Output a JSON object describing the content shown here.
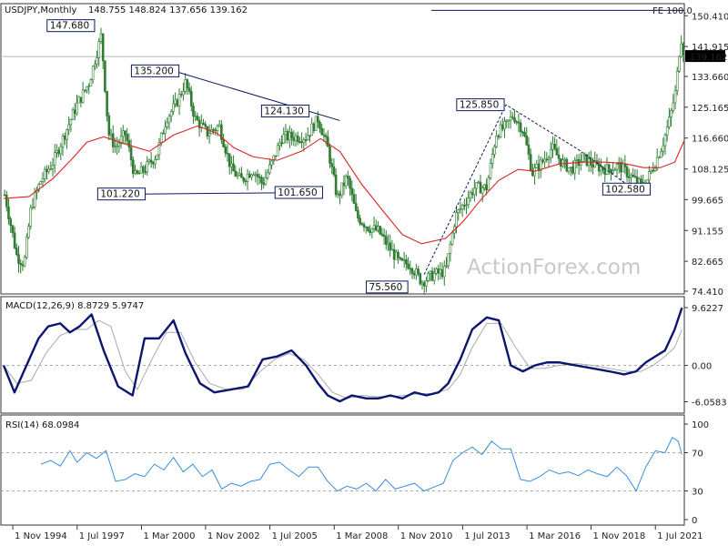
{
  "header": {
    "title": "USDJPY,Monthly",
    "ohlc": "148.755 148.824 137.656 139.162"
  },
  "watermark": "ActionForex.com",
  "fe_label": "FE 100.0",
  "current_price_label": "139.162",
  "colors": {
    "candle": "#2e7d32",
    "sma": "#dd2222",
    "macd": "#0d1570",
    "macd_signal": "#aaaaaa",
    "rsi": "#3a8fd9",
    "trendline": "#0d1a5c",
    "label_border": "#0d1a5c",
    "price_marker_bg": "#000000"
  },
  "chart_data": [
    {
      "type": "candlestick",
      "panel": "price",
      "title": "USDJPY,Monthly",
      "ylim": [
        74.4,
        153.0
      ],
      "y_ticks": [
        150.41,
        141.915,
        133.66,
        125.165,
        116.66,
        108.125,
        99.665,
        91.155,
        82.665,
        74.41
      ],
      "x_ticks": [
        "1 Nov 1994",
        "1 Jul 1997",
        "1 Mar 2000",
        "1 Nov 2002",
        "1 Jul 2005",
        "1 Mar 2008",
        "1 Nov 2010",
        "1 Jul 2013",
        "1 Mar 2016",
        "1 Nov 2018",
        "1 Jul 2021"
      ],
      "x_tick_dates": [
        1994.83,
        1997.5,
        2000.17,
        2002.83,
        2005.5,
        2008.17,
        2010.83,
        2013.5,
        2016.17,
        2018.83,
        2021.5
      ],
      "xlim": [
        1994.45,
        2022.7
      ],
      "series": [
        {
          "name": "USDJPY",
          "x": [
            1994.5,
            1995.0,
            1995.3,
            1995.6,
            1996.0,
            1996.5,
            1997.0,
            1997.5,
            1998.0,
            1998.5,
            1998.8,
            1999.1,
            1999.5,
            1999.9,
            2000.3,
            2000.8,
            2001.2,
            2001.6,
            2002.0,
            2002.4,
            2002.9,
            2003.4,
            2003.9,
            2004.3,
            2004.8,
            2005.2,
            2005.6,
            2006.0,
            2006.5,
            2007.0,
            2007.5,
            2007.9,
            2008.3,
            2008.7,
            2009.1,
            2009.6,
            2010.0,
            2010.5,
            2010.9,
            2011.3,
            2011.8,
            2012.3,
            2012.8,
            2013.2,
            2013.6,
            2014.0,
            2014.5,
            2014.9,
            2015.3,
            2015.6,
            2016.0,
            2016.4,
            2016.8,
            2017.2,
            2017.6,
            2018.0,
            2018.5,
            2019.0,
            2019.5,
            2020.0,
            2020.5,
            2021.0,
            2021.5,
            2021.8,
            2022.1,
            2022.35,
            2022.55,
            2022.7
          ],
          "values": [
            101.0,
            84.0,
            82.0,
            98.0,
            105.0,
            110.0,
            118.0,
            126.0,
            132.0,
            145.0,
            118.0,
            114.0,
            118.0,
            106.0,
            108.0,
            112.0,
            122.0,
            126.0,
            132.0,
            122.0,
            118.0,
            120.0,
            108.0,
            105.0,
            108.0,
            104.0,
            110.0,
            117.0,
            117.0,
            117.0,
            122.0,
            114.0,
            100.0,
            106.0,
            95.0,
            92.0,
            91.0,
            86.0,
            82.0,
            82.0,
            77.0,
            79.0,
            80.0,
            95.0,
            99.0,
            103.0,
            103.0,
            118.0,
            120.0,
            123.0,
            119.0,
            107.0,
            110.0,
            114.0,
            110.0,
            108.0,
            111.0,
            109.0,
            108.0,
            109.0,
            106.0,
            103.0,
            110.0,
            115.0,
            122.0,
            130.0,
            145.0,
            139.162
          ]
        },
        {
          "name": "SMA",
          "x": [
            1994.45,
            1995.5,
            1996.5,
            1997.3,
            1997.9,
            1998.6,
            1999.5,
            2000.5,
            2001.5,
            2002.5,
            2003.3,
            2004.0,
            2004.8,
            2005.8,
            2006.8,
            2007.6,
            2008.4,
            2009.3,
            2010.2,
            2011.0,
            2011.8,
            2012.8,
            2013.5,
            2014.3,
            2015.0,
            2015.8,
            2016.5,
            2017.5,
            2018.5,
            2019.5,
            2020.3,
            2021.0,
            2021.7,
            2022.3,
            2022.7
          ],
          "values": [
            100.0,
            100.5,
            105.5,
            111.0,
            115.5,
            117.0,
            115.0,
            113.0,
            117.5,
            120.0,
            118.0,
            114.0,
            111.5,
            110.5,
            113.0,
            116.5,
            113.0,
            104.0,
            96.5,
            90.0,
            87.5,
            89.0,
            93.5,
            100.0,
            105.0,
            108.0,
            107.5,
            109.5,
            110.0,
            110.0,
            109.5,
            108.5,
            108.5,
            110.0,
            116.0
          ]
        }
      ],
      "annotations": [
        {
          "label": "147.680",
          "x": 1998.3,
          "y": 147.68,
          "side": "left"
        },
        {
          "label": "135.200",
          "x": 2001.8,
          "y": 135.2,
          "side": "left"
        },
        {
          "label": "124.130",
          "x": 2007.2,
          "y": 124.13,
          "side": "left"
        },
        {
          "label": "101.220",
          "x": 2000.4,
          "y": 101.22,
          "side": "left"
        },
        {
          "label": "101.650",
          "x": 2006.7,
          "y": 101.65,
          "side": "center"
        },
        {
          "label": "75.560",
          "x": 2011.3,
          "y": 75.56,
          "side": "left"
        },
        {
          "label": "125.850",
          "x": 2015.3,
          "y": 125.85,
          "side": "left"
        },
        {
          "label": "102.580",
          "x": 2020.3,
          "y": 102.58,
          "side": "center"
        }
      ],
      "lines": [
        {
          "style": "solid",
          "points": [
            [
              2001.5,
              135.2
            ],
            [
              2008.4,
              121.5
            ]
          ]
        },
        {
          "style": "solid",
          "points": [
            [
              2000.2,
              101.22
            ],
            [
              2007.4,
              101.65
            ]
          ]
        },
        {
          "style": "dashed",
          "points": [
            [
              2011.9,
              79.0
            ],
            [
              2015.3,
              125.85
            ],
            [
              2018.3,
              113.5
            ],
            [
              2020.5,
              103.0
            ]
          ]
        },
        {
          "style": "solid",
          "points": [
            [
              2012.2,
              151.9
            ],
            [
              2022.7,
              151.9
            ]
          ]
        }
      ]
    },
    {
      "type": "line",
      "panel": "macd",
      "title": "MACD(12,26,9) 8.8729 5.9747",
      "ylim": [
        -7.5,
        11.0
      ],
      "y_ticks": [
        9.6227,
        0.0,
        -6.0583
      ],
      "y_tick_labels": [
        "9.6227",
        "0.00",
        "-6.0583"
      ],
      "series": [
        {
          "name": "MACD",
          "x": [
            1994.45,
            1994.9,
            1995.4,
            1995.9,
            1996.3,
            1996.8,
            1997.2,
            1997.6,
            1998.1,
            1998.6,
            1999.2,
            1999.8,
            2000.3,
            2000.9,
            2001.5,
            2002.0,
            2002.6,
            2003.2,
            2003.9,
            2004.6,
            2005.2,
            2005.8,
            2006.4,
            2007.0,
            2007.5,
            2007.9,
            2008.4,
            2008.9,
            2009.5,
            2010.0,
            2010.5,
            2011.0,
            2011.5,
            2012.0,
            2012.5,
            2012.9,
            2013.4,
            2013.9,
            2014.5,
            2015.0,
            2015.5,
            2016.0,
            2016.5,
            2017.0,
            2017.5,
            2018.2,
            2018.9,
            2019.6,
            2020.2,
            2020.7,
            2021.1,
            2021.5,
            2021.9,
            2022.3,
            2022.6
          ],
          "values": [
            0.0,
            -4.5,
            0.0,
            4.5,
            6.5,
            7.0,
            5.5,
            6.5,
            8.5,
            2.5,
            -3.5,
            -5.0,
            4.5,
            4.5,
            7.5,
            2.0,
            -3.0,
            -4.5,
            -4.0,
            -3.5,
            1.0,
            1.5,
            2.5,
            0.0,
            -3.0,
            -5.0,
            -6.0,
            -5.0,
            -5.5,
            -5.5,
            -5.0,
            -5.5,
            -4.5,
            -5.0,
            -4.5,
            -3.0,
            1.0,
            6.0,
            8.0,
            7.5,
            0.0,
            -1.0,
            0.0,
            0.5,
            0.5,
            0.0,
            -0.5,
            -1.0,
            -1.5,
            -1.0,
            0.5,
            1.5,
            2.5,
            6.0,
            9.6
          ]
        },
        {
          "name": "Signal",
          "x": [
            1994.45,
            1995.0,
            1995.6,
            1996.2,
            1996.8,
            1997.4,
            1997.9,
            1998.4,
            1998.9,
            1999.5,
            2000.0,
            2000.6,
            2001.2,
            2001.8,
            2002.4,
            2003.0,
            2003.7,
            2004.4,
            2005.1,
            2005.7,
            2006.3,
            2006.9,
            2007.5,
            2008.1,
            2008.7,
            2009.3,
            2009.9,
            2010.5,
            2011.1,
            2011.7,
            2012.3,
            2012.9,
            2013.4,
            2013.9,
            2014.5,
            2015.1,
            2015.7,
            2016.3,
            2016.9,
            2017.5,
            2018.2,
            2018.9,
            2019.6,
            2020.3,
            2020.9,
            2021.4,
            2021.9,
            2022.3,
            2022.6
          ],
          "values": [
            0.0,
            -3.0,
            -2.5,
            2.0,
            5.0,
            6.0,
            6.0,
            7.5,
            6.5,
            -1.0,
            -4.0,
            1.0,
            5.5,
            5.5,
            0.5,
            -3.0,
            -4.0,
            -4.0,
            -1.0,
            1.0,
            2.0,
            1.0,
            -1.5,
            -4.5,
            -5.5,
            -5.0,
            -5.2,
            -5.2,
            -5.0,
            -4.7,
            -4.7,
            -4.0,
            -1.5,
            3.0,
            7.0,
            7.0,
            3.0,
            -0.5,
            -0.5,
            0.0,
            0.3,
            0.0,
            -0.5,
            -1.0,
            -1.0,
            0.0,
            1.5,
            3.0,
            6.0
          ]
        }
      ]
    },
    {
      "type": "line",
      "panel": "rsi",
      "title": "RSI(14) 68.0984",
      "ylim": [
        0,
        100
      ],
      "y_ticks": [
        100,
        70,
        30,
        0
      ],
      "levels": [
        70,
        30
      ],
      "series": [
        {
          "name": "RSI",
          "x": [
            1996.0,
            1996.4,
            1996.8,
            1997.2,
            1997.5,
            1997.9,
            1998.3,
            1998.7,
            1999.1,
            1999.5,
            1999.9,
            2000.3,
            2000.7,
            2001.1,
            2001.5,
            2001.9,
            2002.3,
            2002.7,
            2003.1,
            2003.5,
            2003.9,
            2004.3,
            2004.7,
            2005.1,
            2005.5,
            2005.9,
            2006.3,
            2006.7,
            2007.1,
            2007.5,
            2007.9,
            2008.3,
            2008.7,
            2009.1,
            2009.5,
            2009.9,
            2010.3,
            2010.7,
            2011.1,
            2011.5,
            2011.9,
            2012.3,
            2012.7,
            2013.1,
            2013.5,
            2013.9,
            2014.3,
            2014.7,
            2015.1,
            2015.5,
            2015.9,
            2016.3,
            2016.7,
            2017.1,
            2017.5,
            2017.9,
            2018.3,
            2018.7,
            2019.1,
            2019.5,
            2019.9,
            2020.3,
            2020.7,
            2021.1,
            2021.5,
            2021.9,
            2022.2,
            2022.45,
            2022.6
          ],
          "values": [
            58,
            62,
            56,
            72,
            60,
            70,
            64,
            72,
            40,
            42,
            48,
            45,
            58,
            52,
            65,
            50,
            58,
            45,
            52,
            32,
            38,
            35,
            40,
            42,
            58,
            60,
            52,
            45,
            55,
            55,
            40,
            30,
            35,
            32,
            38,
            30,
            42,
            32,
            35,
            38,
            30,
            34,
            38,
            62,
            70,
            76,
            68,
            82,
            74,
            74,
            42,
            40,
            45,
            52,
            48,
            50,
            46,
            52,
            48,
            45,
            55,
            46,
            30,
            55,
            72,
            70,
            86,
            82,
            68
          ]
        }
      ]
    }
  ]
}
